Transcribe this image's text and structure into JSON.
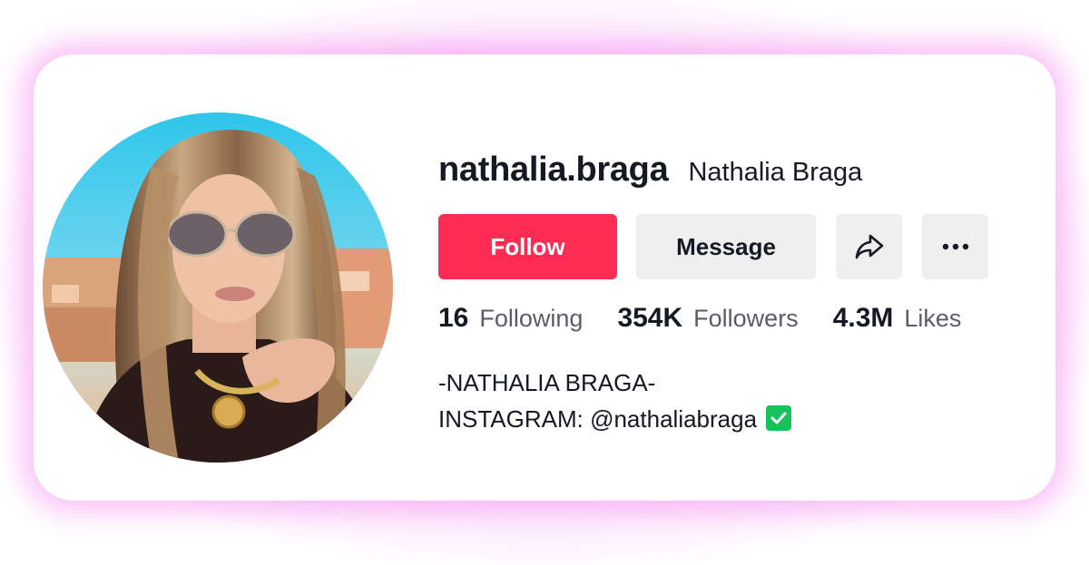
{
  "profile": {
    "username": "nathalia.braga",
    "display_name": "Nathalia Braga"
  },
  "actions": {
    "follow_label": "Follow",
    "message_label": "Message",
    "share_icon": "share-icon",
    "more_icon": "more-icon"
  },
  "stats": [
    {
      "value": "16",
      "label": "Following"
    },
    {
      "value": "354K",
      "label": "Followers"
    },
    {
      "value": "4.3M",
      "label": "Likes"
    }
  ],
  "bio": {
    "line1": "-NATHALIA BRAGA-",
    "line2": "INSTAGRAM: @nathaliabraga",
    "verified_icon": "check-mark-icon"
  },
  "colors": {
    "follow_bg": "#fe2c55",
    "button_bg": "#efefef",
    "text": "#161823",
    "glow": "#f8a5f6",
    "check": "#18c25a"
  }
}
